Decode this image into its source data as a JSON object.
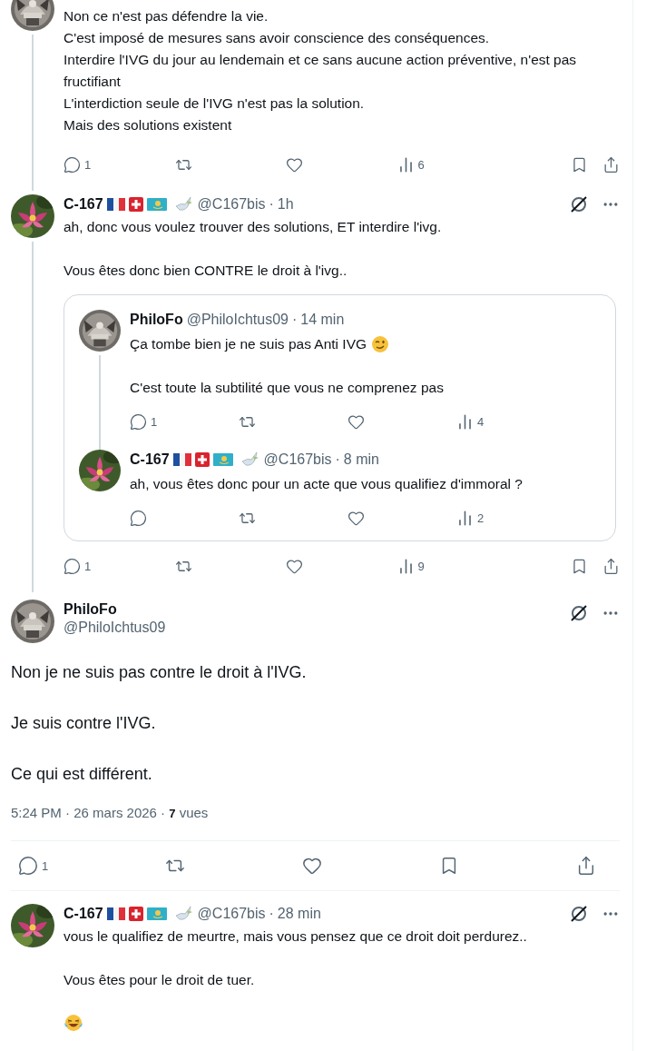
{
  "thread": [
    {
      "continues_below": true,
      "paragraphs": [
        {
          "kind": "text",
          "text": "Non ce n'est pas défendre la vie.\nC'est imposé de mesures sans avoir conscience des conséquences.\nInterdire l'IVG du jour au lendemain et ce sans aucune action préventive, n'est pas fructifiant\nL'interdiction seule de l'IVG n'est pas la solution.\nMais des solutions existent"
        }
      ],
      "actions": {
        "replies": "1",
        "views": "6"
      }
    },
    {
      "continues_below": true,
      "author": {
        "name": "C-167",
        "flag_badges": true,
        "handle": "@C167bis",
        "separator": "·",
        "time": "1h"
      },
      "paragraphs": [
        {
          "kind": "text",
          "text": "ah, donc vous voulez trouver des solutions, ET interdire l'ivg."
        },
        {
          "kind": "text",
          "text": "Vous êtes donc bien CONTRE le droit à l'ivg.."
        }
      ],
      "quote": [
        {
          "continues_below": true,
          "author": {
            "name": "PhiloFo",
            "flag_badges": false,
            "handle": "@PhiloIchtus09",
            "separator": "·",
            "time": "14 min"
          },
          "paragraphs": [
            {
              "kind": "text-wink",
              "text": "Ça tombe bien je ne suis pas Anti IVG"
            },
            {
              "kind": "text",
              "text": "C'est toute la subtilité que vous ne comprenez pas"
            }
          ],
          "actions": {
            "replies": "1",
            "views": "4"
          }
        },
        {
          "continues_below": false,
          "author": {
            "name": "C-167",
            "flag_badges": true,
            "handle": "@C167bis",
            "separator": "·",
            "time": "8 min"
          },
          "paragraphs": [
            {
              "kind": "text",
              "text": "ah, vous êtes donc pour un acte que vous qualifiez d'immoral ?"
            }
          ],
          "actions": {
            "views": "2"
          }
        }
      ],
      "actions": {
        "replies": "1",
        "views": "9"
      }
    }
  ],
  "main_post": {
    "name": "PhiloFo",
    "handle": "@PhiloIchtus09",
    "paragraphs": [
      "Non je ne suis pas contre le droit à l'IVG.",
      "Je suis contre l'IVG.",
      "Ce qui est différent."
    ],
    "meta": "5:24 PM · 26 mars 2026 · **7** vues",
    "actions": {
      "replies": "1"
    }
  },
  "replies": [
    {
      "continues_below": false,
      "author": {
        "name": "C-167",
        "flag_badges": true,
        "handle": "@C167bis",
        "separator": "·",
        "time": "28 min"
      },
      "paragraphs": [
        {
          "kind": "text",
          "text": "vous le qualifiez de meurtre, mais vous pensez que ce droit doit perdurez.."
        },
        {
          "kind": "text",
          "text": "Vous êtes pour le droit de tuer."
        },
        {
          "kind": "emoji-laugh"
        }
      ]
    }
  ]
}
